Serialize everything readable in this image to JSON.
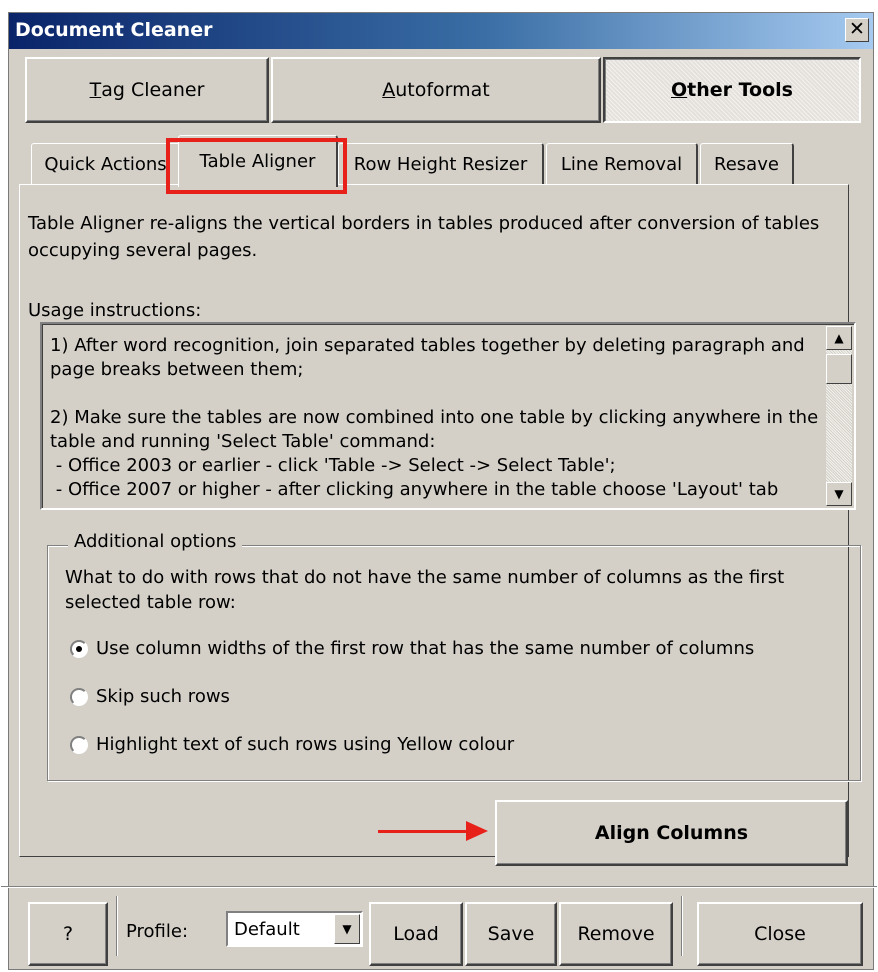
{
  "window": {
    "title": "Document Cleaner",
    "close_glyph": "✕"
  },
  "top_buttons": [
    {
      "label": "Tag Cleaner",
      "mnemonic": "T",
      "rest": "ag Cleaner"
    },
    {
      "label": "Autoformat",
      "mnemonic": "A",
      "rest": "utoformat"
    },
    {
      "label": "Other Tools",
      "mnemonic": "O",
      "rest": "ther Tools",
      "pressed": true
    }
  ],
  "tabs": [
    {
      "label": "Quick Actions"
    },
    {
      "label": "Table Aligner",
      "active": true
    },
    {
      "label": "Row Height Resizer"
    },
    {
      "label": "Line Removal"
    },
    {
      "label": "Resave"
    }
  ],
  "panel": {
    "description": "Table Aligner re-aligns the vertical borders in tables produced after conversion of tables occupying several pages.",
    "usage_label": "Usage instructions:",
    "usage_text": "1) After word recognition, join separated tables together by deleting paragraph and page breaks between them;\n\n2) Make sure the tables are now combined into one table by clicking anywhere in the table and running 'Select Table' command:\n - Office 2003 or earlier - click 'Table -> Select -> Select Table';\n - Office 2007 or higher - after clicking anywhere in the table choose 'Layout' tab",
    "additional_options": {
      "legend": "Additional options",
      "question": "What to do with rows that do not have the same number of columns as the first selected table row:",
      "options": [
        {
          "label": "Use column widths of the first row that has the same number of columns",
          "selected": true
        },
        {
          "label": "Skip such rows",
          "selected": false
        },
        {
          "label": "Highlight text of such rows using Yellow colour",
          "selected": false
        }
      ]
    },
    "align_button": "Align Columns"
  },
  "bottom": {
    "help": "?",
    "profile_label": "Profile:",
    "profile_value": "Default",
    "load": "Load",
    "save": "Save",
    "remove": "Remove",
    "close": "Close"
  },
  "colors": {
    "annotation": "#e8201a",
    "dialog_face": "#d4d0c8",
    "title_start": "#0a246a"
  },
  "icons": {
    "scroll_up": "up-arrow-icon",
    "scroll_down": "down-arrow-icon",
    "dropdown": "chevron-down-icon"
  }
}
